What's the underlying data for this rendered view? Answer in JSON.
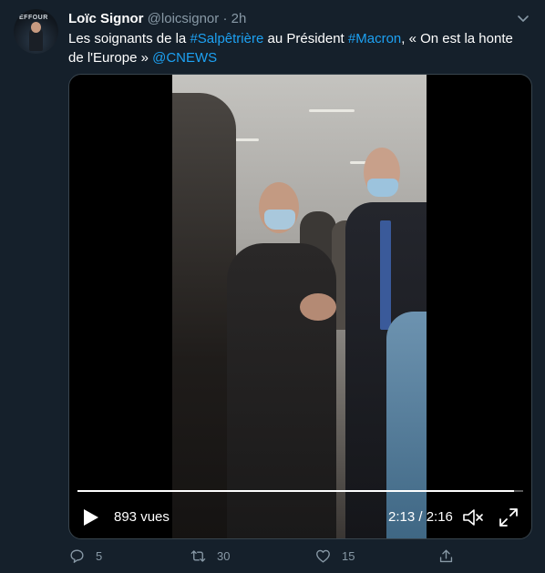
{
  "tweet": {
    "author_name": "Loïc Signor",
    "author_handle": "@loicsignor",
    "separator": "·",
    "time": "2h",
    "avatar_text": "EFFOUR",
    "text_parts": {
      "p1": "Les soignants de la ",
      "hashtag1": "#Salpêtrière",
      "p2": " au Président ",
      "hashtag2": "#Macron",
      "p3": ", « On est la honte de l'Europe » ",
      "mention": "@CNEWS"
    }
  },
  "video": {
    "views": "893 vues",
    "timecode": "2:13 / 2:16",
    "progress": 0.98,
    "play_icon": "play-icon",
    "volume_icon": "volume-icon",
    "fullscreen_icon": "fullscreen-icon"
  },
  "actions": {
    "reply_count": "5",
    "retweet_count": "30",
    "like_count": "15"
  },
  "colors": {
    "background": "#15202b",
    "link": "#1da1f2",
    "muted": "#8899a6",
    "border": "#38444d"
  }
}
